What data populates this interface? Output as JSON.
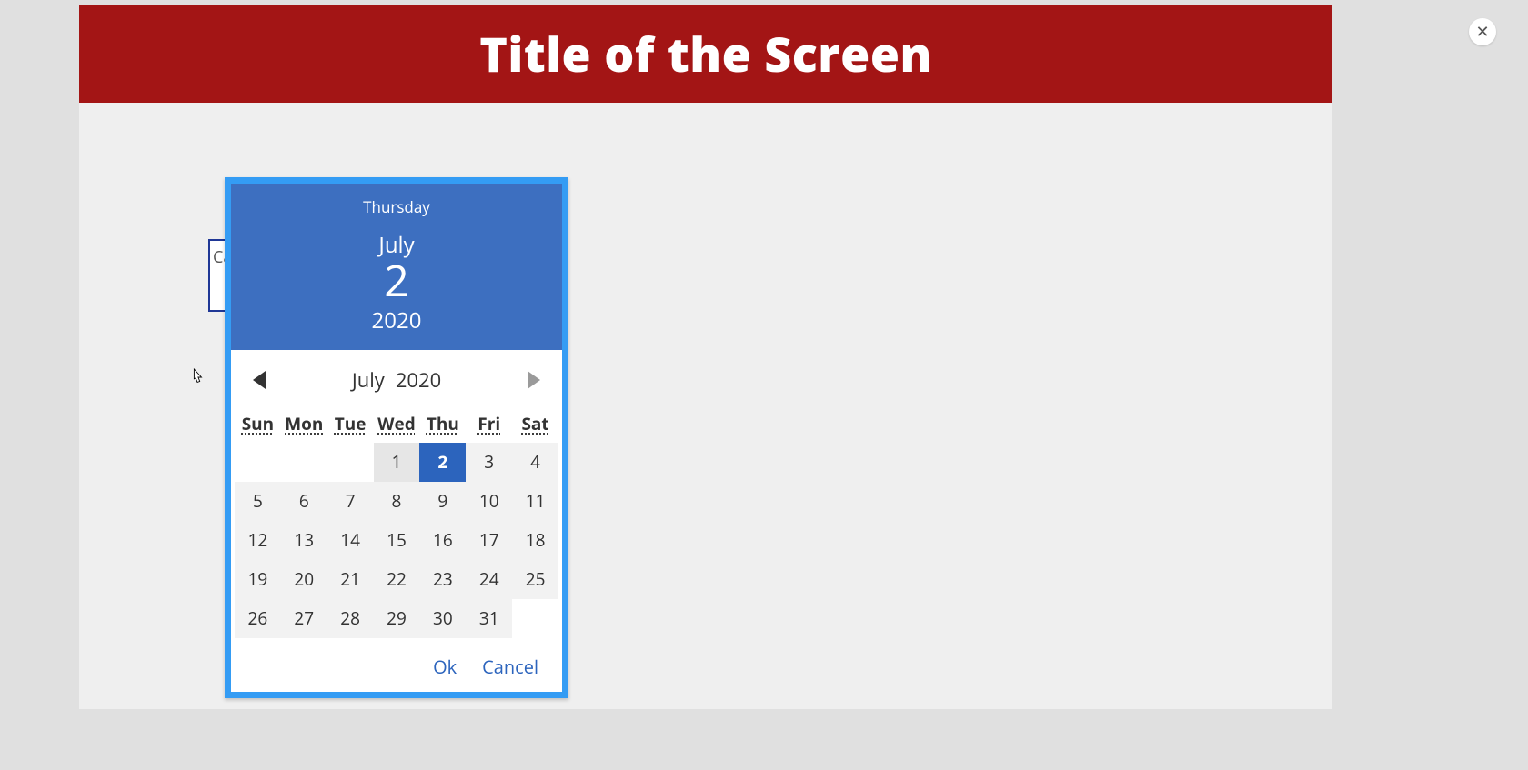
{
  "header": {
    "title": "Title of the Screen"
  },
  "close": {
    "glyph": "✕"
  },
  "date_input": {
    "peek_text": "Ca"
  },
  "datepicker": {
    "header": {
      "day_of_week": "Thursday",
      "month": "July",
      "day": "2",
      "year": "2020"
    },
    "nav": {
      "month": "July",
      "year": "2020"
    },
    "weekdays": [
      "Sun",
      "Mon",
      "Tue",
      "Wed",
      "Thu",
      "Fri",
      "Sat"
    ],
    "leading_blanks": 3,
    "selected_day": 2,
    "today_day": 1,
    "days_in_month": 31,
    "actions": {
      "ok": "Ok",
      "cancel": "Cancel"
    }
  }
}
